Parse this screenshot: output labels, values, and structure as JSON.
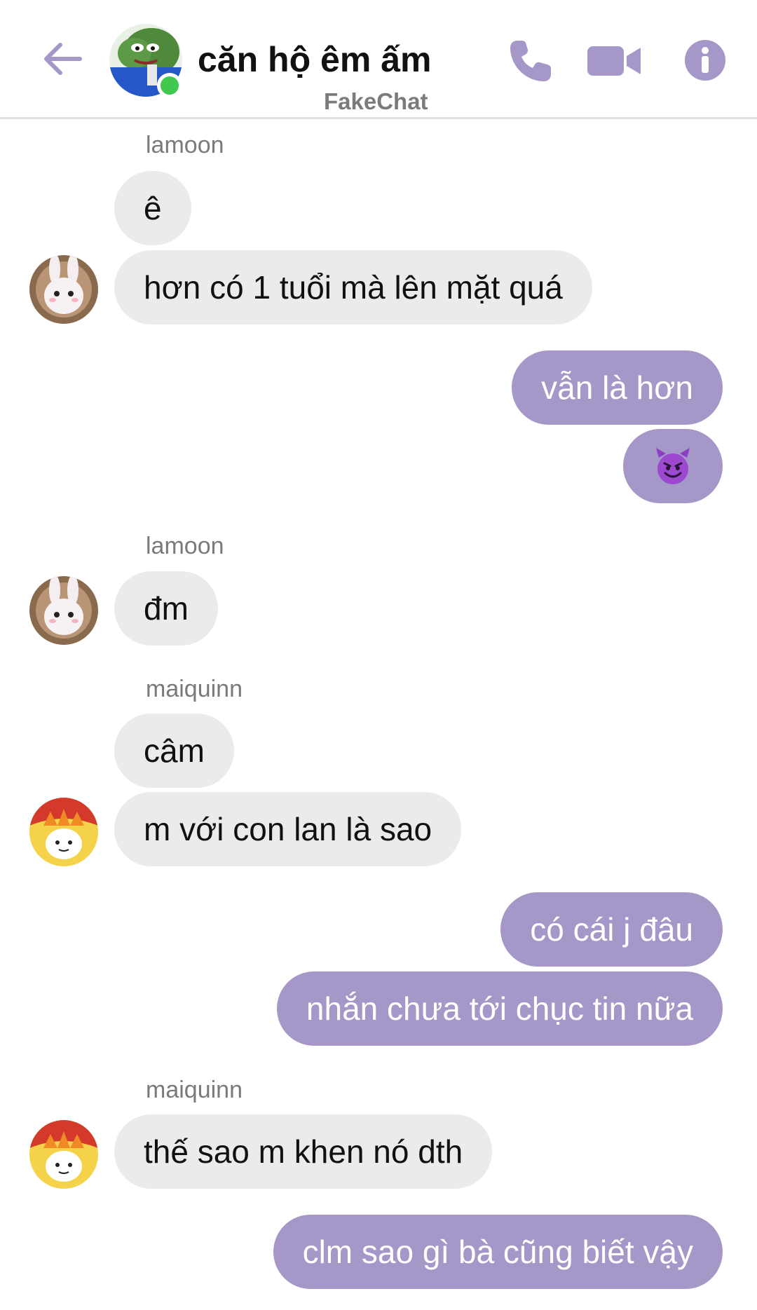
{
  "header": {
    "title": "căn hộ êm ấm",
    "subtitle": "FakeChat",
    "accent_color": "#a597c7",
    "icons": [
      "arrow-left-icon",
      "phone-icon",
      "video-camera-icon",
      "info-icon"
    ]
  },
  "messages": [
    {
      "sender": "lamoon",
      "text": "ê"
    },
    {
      "text": "hơn có 1 tuổi mà lên mặt quá"
    },
    {
      "text": "vẫn là hơn"
    },
    {
      "text": "😈"
    },
    {
      "sender": "lamoon",
      "text": "đm"
    },
    {
      "sender": "maiquinn",
      "text": "câm"
    },
    {
      "text": "m với con lan là sao"
    },
    {
      "text": "có cái j đâu"
    },
    {
      "text": "nhắn chưa tới chục tin nữa"
    },
    {
      "sender": "maiquinn",
      "text": "thế sao m khen nó dth"
    },
    {
      "text": "clm sao gì bà cũng biết vậy"
    }
  ],
  "colors": {
    "incoming_bubble": "#ebebeb",
    "outgoing_bubble": "#a597c7",
    "online": "#41c94f"
  }
}
